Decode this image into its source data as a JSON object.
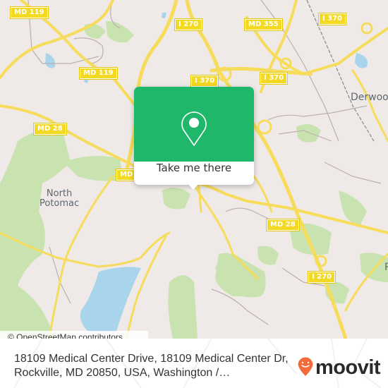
{
  "map": {
    "road_labels": [
      {
        "id": "md119-nw",
        "text": "MD 119"
      },
      {
        "id": "i270-n",
        "text": "I 270"
      },
      {
        "id": "md355",
        "text": "MD 355"
      },
      {
        "id": "i370-ne",
        "text": "I 370"
      },
      {
        "id": "md119-w",
        "text": "MD 119"
      },
      {
        "id": "i370-a",
        "text": "I 370"
      },
      {
        "id": "i370-b",
        "text": "I 370"
      },
      {
        "id": "md28-w",
        "text": "MD 28"
      },
      {
        "id": "md-partial",
        "text": "MD"
      },
      {
        "id": "md28-e",
        "text": "MD 28"
      },
      {
        "id": "i270-s",
        "text": "I 270"
      }
    ],
    "place_labels": {
      "north_potomac": "North\nPotomac",
      "derwood": "Derwood",
      "r_partial": "R"
    },
    "attribution": "© OpenStreetMap contributors",
    "colors": {
      "background": "#efeae8",
      "road": "#f6dc5a",
      "road_shield": "#f4d922",
      "park": "#c9e3b0",
      "water": "#a8d5ec",
      "minor_road": "#b9b0ad"
    }
  },
  "popup": {
    "icon": "map-pin-icon",
    "button_label": "Take me there",
    "accent_color": "#1fb86a"
  },
  "footer": {
    "address": "18109 Medical Center Drive, 18109 Medical Center Dr, Rockville, MD 20850, USA, Washington /…",
    "brand": "moovit",
    "brand_color": "#f26b3a"
  }
}
